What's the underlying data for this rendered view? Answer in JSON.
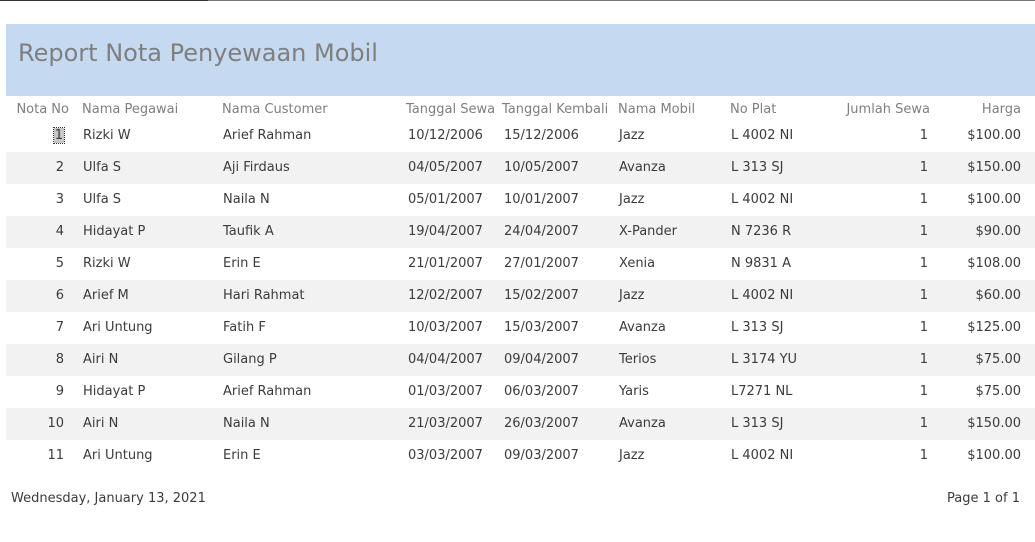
{
  "report": {
    "title": "Report Nota Penyewaan Mobil"
  },
  "columns": {
    "nota_no": "Nota No",
    "nama_pegawai": "Nama Pegawai",
    "nama_customer": "Nama Customer",
    "tanggal_sewa": "Tanggal Sewa",
    "tanggal_kembali": "Tanggal Kembali",
    "nama_mobil": "Nama Mobil",
    "no_plat": "No Plat",
    "jumlah_sewa": "Jumlah Sewa",
    "harga": "Harga"
  },
  "rows": [
    {
      "nota_no": "1",
      "nama_pegawai": "Rizki W",
      "nama_customer": "Arief Rahman",
      "tanggal_sewa": "10/12/2006",
      "tanggal_kembali": "15/12/2006",
      "nama_mobil": "Jazz",
      "no_plat": "L 4002 NI",
      "jumlah_sewa": "1",
      "harga": "$100.00"
    },
    {
      "nota_no": "2",
      "nama_pegawai": "Ulfa S",
      "nama_customer": "Aji Firdaus",
      "tanggal_sewa": "04/05/2007",
      "tanggal_kembali": "10/05/2007",
      "nama_mobil": "Avanza",
      "no_plat": "L 313 SJ",
      "jumlah_sewa": "1",
      "harga": "$150.00"
    },
    {
      "nota_no": "3",
      "nama_pegawai": "Ulfa S",
      "nama_customer": "Naila N",
      "tanggal_sewa": "05/01/2007",
      "tanggal_kembali": "10/01/2007",
      "nama_mobil": "Jazz",
      "no_plat": "L 4002 NI",
      "jumlah_sewa": "1",
      "harga": "$100.00"
    },
    {
      "nota_no": "4",
      "nama_pegawai": "Hidayat P",
      "nama_customer": "Taufik A",
      "tanggal_sewa": "19/04/2007",
      "tanggal_kembali": "24/04/2007",
      "nama_mobil": "X-Pander",
      "no_plat": "N 7236 R",
      "jumlah_sewa": "1",
      "harga": "$90.00"
    },
    {
      "nota_no": "5",
      "nama_pegawai": "Rizki W",
      "nama_customer": "Erin E",
      "tanggal_sewa": "21/01/2007",
      "tanggal_kembali": "27/01/2007",
      "nama_mobil": "Xenia",
      "no_plat": "N 9831 A",
      "jumlah_sewa": "1",
      "harga": "$108.00"
    },
    {
      "nota_no": "6",
      "nama_pegawai": "Arief M",
      "nama_customer": "Hari Rahmat",
      "tanggal_sewa": "12/02/2007",
      "tanggal_kembali": "15/02/2007",
      "nama_mobil": "Jazz",
      "no_plat": "L 4002 NI",
      "jumlah_sewa": "1",
      "harga": "$60.00"
    },
    {
      "nota_no": "7",
      "nama_pegawai": "Ari Untung",
      "nama_customer": "Fatih F",
      "tanggal_sewa": "10/03/2007",
      "tanggal_kembali": "15/03/2007",
      "nama_mobil": "Avanza",
      "no_plat": "L 313 SJ",
      "jumlah_sewa": "1",
      "harga": "$125.00"
    },
    {
      "nota_no": "8",
      "nama_pegawai": "Airi N",
      "nama_customer": "Gilang P",
      "tanggal_sewa": "04/04/2007",
      "tanggal_kembali": "09/04/2007",
      "nama_mobil": "Terios",
      "no_plat": "L 3174 YU",
      "jumlah_sewa": "1",
      "harga": "$75.00"
    },
    {
      "nota_no": "9",
      "nama_pegawai": "Hidayat P",
      "nama_customer": "Arief Rahman",
      "tanggal_sewa": "01/03/2007",
      "tanggal_kembali": "06/03/2007",
      "nama_mobil": "Yaris",
      "no_plat": "L7271 NL",
      "jumlah_sewa": "1",
      "harga": "$75.00"
    },
    {
      "nota_no": "10",
      "nama_pegawai": "Airi N",
      "nama_customer": "Naila N",
      "tanggal_sewa": "21/03/2007",
      "tanggal_kembali": "26/03/2007",
      "nama_mobil": "Avanza",
      "no_plat": "L 313 SJ",
      "jumlah_sewa": "1",
      "harga": "$150.00"
    },
    {
      "nota_no": "11",
      "nama_pegawai": "Ari Untung",
      "nama_customer": "Erin E",
      "tanggal_sewa": "03/03/2007",
      "tanggal_kembali": "09/03/2007",
      "nama_mobil": "Jazz",
      "no_plat": "L 4002 NI",
      "jumlah_sewa": "1",
      "harga": "$100.00"
    }
  ],
  "footer": {
    "date": "Wednesday, January 13, 2021",
    "page": "Page 1 of 1"
  },
  "colors": {
    "header_band": "#c5d9f1",
    "alt_row": "#f2f2f2",
    "muted_text": "#7f7f7f"
  }
}
